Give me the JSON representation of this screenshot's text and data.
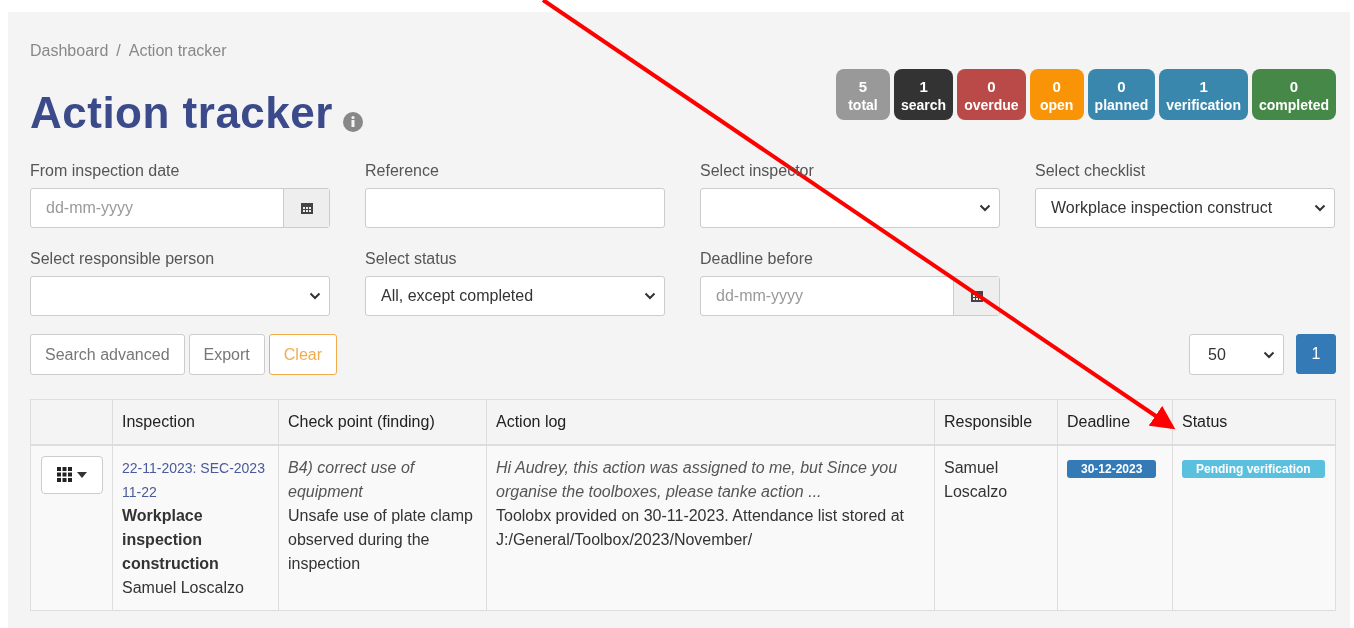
{
  "breadcrumb": {
    "items": [
      "Dashboard",
      "Action tracker"
    ],
    "separator": "/"
  },
  "title": "Action tracker",
  "counters": [
    {
      "value": "5",
      "label": "total",
      "color": "#999999"
    },
    {
      "value": "1",
      "label": "search",
      "color": "#333333"
    },
    {
      "value": "0",
      "label": "overdue",
      "color": "#b94a48"
    },
    {
      "value": "0",
      "label": "open",
      "color": "#f89406"
    },
    {
      "value": "0",
      "label": "planned",
      "color": "#3a87ad"
    },
    {
      "value": "1",
      "label": "verification",
      "color": "#3a87ad"
    },
    {
      "value": "0",
      "label": "completed",
      "color": "#468847"
    }
  ],
  "filters": [
    {
      "label": "From inspection date",
      "kind": "date",
      "placeholder": "dd-mm-yyyy"
    },
    {
      "label": "Reference",
      "kind": "text"
    },
    {
      "label": "Select inspector",
      "kind": "select"
    },
    {
      "label": "Select checklist",
      "kind": "select",
      "value": "Workplace inspection construct"
    },
    {
      "label": "Select responsible person",
      "kind": "select"
    },
    {
      "label": "Select status",
      "kind": "select",
      "value": "All, except completed"
    },
    {
      "label": "Deadline before",
      "kind": "date",
      "placeholder": "dd-mm-yyyy"
    }
  ],
  "buttons": [
    {
      "label": "Search advanced",
      "kind": "default"
    },
    {
      "label": "Export",
      "kind": "default"
    },
    {
      "label": "Clear",
      "kind": "warning"
    }
  ],
  "page_size": "50",
  "pagination": [
    {
      "label": "1",
      "selected": true
    }
  ],
  "table": {
    "columns": [
      "Inspection",
      "Check point (finding)",
      "Action log",
      "Responsible",
      "Deadline",
      "Status"
    ],
    "rows": [
      {
        "inspection": {
          "reference": "22-11-2023: SEC-2023 11-22",
          "checklist": "Workplace inspection construction",
          "inspector": "Samuel Loscalzo"
        },
        "checkpoint": {
          "title": "B4) correct use of equipment",
          "finding": "Unsafe use of plate clamp observed during the inspection"
        },
        "action_log": {
          "message": "Hi Audrey, this action was assigned to me, but Since you organise the toolboxes, please tanke action ...",
          "note": "Toolobx provided on 30-11-2023. Attendance list stored at J:/General/Toolbox/2023/November/"
        },
        "responsible": "Samuel Loscalzo",
        "deadline": "30-12-2023",
        "status": "Pending verification"
      }
    ]
  }
}
